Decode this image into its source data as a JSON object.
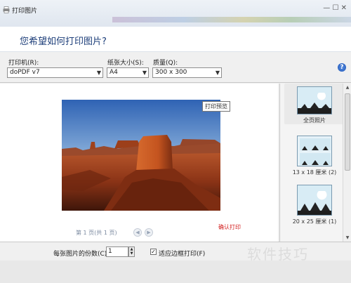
{
  "window": {
    "title": "打印图片",
    "controls": "— ☐ ✕"
  },
  "header": {
    "question": "您希望如何打印图片?"
  },
  "toolbar": {
    "printer_label": "打印机(R):",
    "printer_value": "doPDF v7",
    "paper_label": "纸张大小(S):",
    "paper_value": "A4",
    "quality_label": "质量(Q):",
    "quality_value": "300 x 300",
    "help_glyph": "?"
  },
  "preview": {
    "tooltip": "打印预览",
    "page_info": "第 1 页(共 1 页)",
    "prev_glyph": "◀",
    "next_glyph": "▶",
    "print_link": "确认打印"
  },
  "layouts": [
    {
      "label": "全页照片",
      "selected": true
    },
    {
      "label": "13 x 18 厘米 (2)",
      "selected": false
    },
    {
      "label": "20 x 25 厘米 (1)",
      "selected": false
    }
  ],
  "footer": {
    "copies_label": "每张图片的份数(C):",
    "copies_value": "1",
    "fit_label": "适应边框打印(F)",
    "fit_checked_glyph": "✓"
  },
  "watermark": "软件技巧",
  "colors": {
    "accent_blue": "#1e3f7a",
    "link_red": "#d32020"
  }
}
